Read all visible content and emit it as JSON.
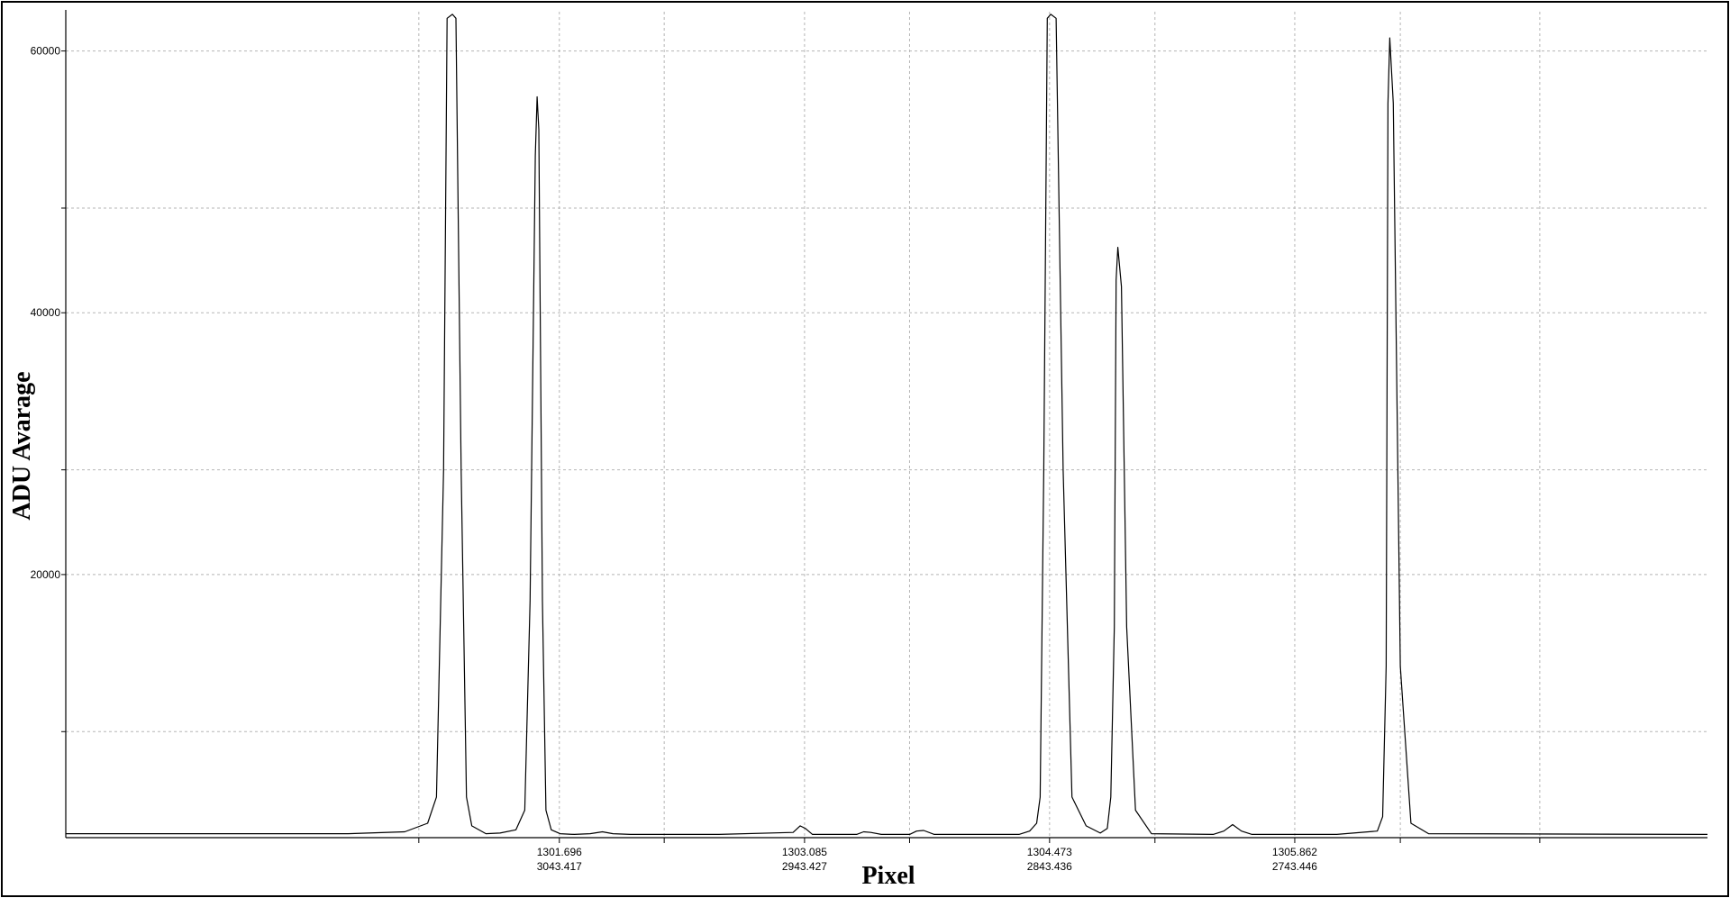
{
  "chart_data": {
    "type": "line",
    "xlabel": "Pixel",
    "ylabel": "ADU Avarage",
    "ylim": [
      -100,
      63000
    ],
    "xlim": [
      1298.9,
      1308.2
    ],
    "grid": true,
    "y_ticks": [
      {
        "value": 8000,
        "label": ""
      },
      {
        "value": 20000,
        "label": "20000"
      },
      {
        "value": 28000,
        "label": ""
      },
      {
        "value": 40000,
        "label": "40000"
      },
      {
        "value": 48000,
        "label": ""
      },
      {
        "value": 60000,
        "label": "60000"
      }
    ],
    "x_ticks": [
      {
        "value": 1300.9,
        "primary": "",
        "secondary": ""
      },
      {
        "value": 1301.696,
        "primary": "1301.696",
        "secondary": "3043.417"
      },
      {
        "value": 1302.29,
        "primary": "",
        "secondary": ""
      },
      {
        "value": 1303.085,
        "primary": "1303.085",
        "secondary": "2943.427"
      },
      {
        "value": 1303.68,
        "primary": "",
        "secondary": ""
      },
      {
        "value": 1304.473,
        "primary": "1304.473",
        "secondary": "2843.436"
      },
      {
        "value": 1305.07,
        "primary": "",
        "secondary": ""
      },
      {
        "value": 1305.862,
        "primary": "1305.862",
        "secondary": "2743.446"
      },
      {
        "value": 1306.46,
        "primary": "",
        "secondary": ""
      },
      {
        "value": 1307.25,
        "primary": "",
        "secondary": ""
      }
    ],
    "series": [
      {
        "x": [
          1298.9,
          1299.9,
          1300.5,
          1300.82,
          1300.95,
          1301.0,
          1301.04,
          1301.06,
          1301.09,
          1301.11,
          1301.14,
          1301.17,
          1301.2,
          1301.28,
          1301.36,
          1301.45,
          1301.5,
          1301.53,
          1301.56,
          1301.57,
          1301.58,
          1301.6,
          1301.62,
          1301.65,
          1301.7,
          1301.78,
          1301.87,
          1301.94,
          1302.0,
          1302.1,
          1302.6,
          1303.02,
          1303.06,
          1303.09,
          1303.13,
          1303.2,
          1303.38,
          1303.42,
          1303.46,
          1303.52,
          1303.68,
          1303.72,
          1303.76,
          1303.82,
          1304.3,
          1304.36,
          1304.4,
          1304.42,
          1304.44,
          1304.46,
          1304.48,
          1304.51,
          1304.55,
          1304.6,
          1304.68,
          1304.76,
          1304.8,
          1304.82,
          1304.84,
          1304.85,
          1304.86,
          1304.88,
          1304.91,
          1304.96,
          1305.05,
          1305.4,
          1305.46,
          1305.51,
          1305.56,
          1305.62,
          1306.1,
          1306.33,
          1306.36,
          1306.38,
          1306.39,
          1306.4,
          1306.42,
          1306.46,
          1306.52,
          1306.62,
          1308.2
        ],
        "y": [
          200,
          200,
          200,
          350,
          1000,
          3000,
          28000,
          62500,
          62800,
          62500,
          28000,
          3000,
          800,
          200,
          250,
          500,
          2000,
          18000,
          52000,
          56500,
          54000,
          18000,
          2000,
          500,
          200,
          150,
          200,
          350,
          200,
          150,
          150,
          300,
          800,
          600,
          150,
          150,
          150,
          350,
          300,
          150,
          150,
          400,
          450,
          150,
          150,
          400,
          1000,
          3000,
          28000,
          62500,
          62800,
          62500,
          28000,
          3000,
          800,
          250,
          600,
          3000,
          16000,
          42500,
          45000,
          42000,
          16000,
          2000,
          200,
          150,
          400,
          900,
          400,
          150,
          150,
          400,
          1500,
          13000,
          56000,
          61000,
          56000,
          13000,
          1000,
          200,
          150
        ]
      }
    ]
  }
}
